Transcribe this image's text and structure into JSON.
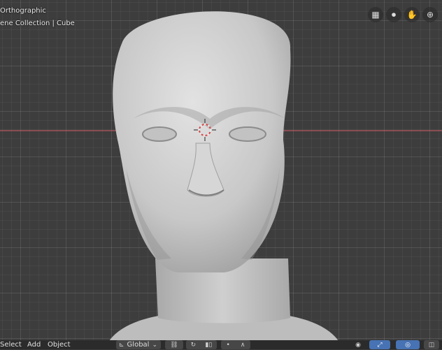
{
  "viewport": {
    "view_name": "Orthographic",
    "collection_label": "ene Collection | Cube",
    "nav_icons": [
      "grid-icon",
      "camera-icon",
      "hand-pan-icon",
      "zoom-icon"
    ]
  },
  "header": {
    "menus": [
      "Select",
      "Add",
      "Object"
    ],
    "transform_orientation": "Global"
  },
  "colors": {
    "grid_bg": "#3d3d3d",
    "x_axis": "#a8505a",
    "header_bg": "#2b2b2b",
    "mesh": "#c9c9c9"
  }
}
